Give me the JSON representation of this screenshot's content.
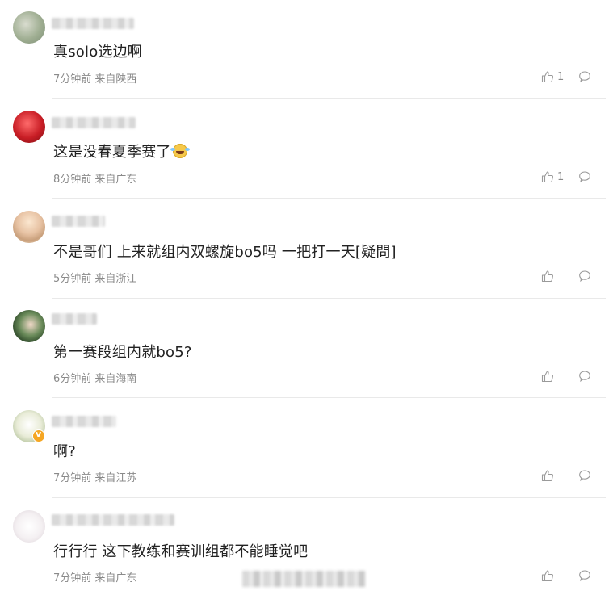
{
  "comments": [
    {
      "text": "真solo选边啊",
      "meta": "7分钟前 来自陕西",
      "likes": "1"
    },
    {
      "text": "这是没春夏季赛了",
      "meta": "8分钟前 来自广东",
      "likes": "1",
      "emoji": "laugh-cry-emoji"
    },
    {
      "text": "不是哥们 上来就组内双螺旋bo5吗 一把打一天[疑問]",
      "meta": "5分钟前 来自浙江"
    },
    {
      "text": "第一赛段组内就bo5?",
      "meta": "6分钟前 来自海南"
    },
    {
      "text": "啊?",
      "meta": "7分钟前 来自江苏",
      "verified": true
    },
    {
      "text": "行行行 这下教练和赛训组都不能睡觉吧",
      "meta": "7分钟前 来自广东"
    }
  ],
  "icons": {
    "like": "thumbs-up-icon",
    "reply": "comment-bubble-icon"
  },
  "colors": {
    "text": "#222222",
    "meta": "#8a8a8a",
    "divider": "#e9e9e9",
    "icon": "#9a9a9a"
  }
}
